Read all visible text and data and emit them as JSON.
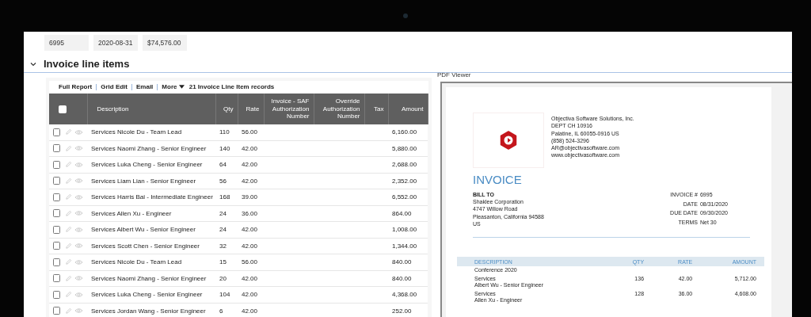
{
  "record_fields": [
    "6995",
    "2020-08-31",
    "$74,576.00"
  ],
  "section": {
    "title": "Invoice line items",
    "expanded": true
  },
  "grid": {
    "toolbar": [
      {
        "label": "Full Report",
        "kind": "link"
      },
      {
        "label": "Grid Edit",
        "kind": "link"
      },
      {
        "label": "Email",
        "kind": "link"
      },
      {
        "label": "More",
        "kind": "menu"
      }
    ],
    "record_count": "21 Invoice Line Item records",
    "select_all_checked": false,
    "columns": [
      {
        "label": "Description",
        "kind": "description"
      },
      {
        "label": "Qty",
        "kind": "qty"
      },
      {
        "label": "Rate",
        "kind": "rate"
      },
      {
        "label": "Invoice - SAF Authorization Number",
        "kind": "saf"
      },
      {
        "label": "Override Authorization Number",
        "kind": "override"
      },
      {
        "label": "Tax",
        "kind": "tax"
      },
      {
        "label": "Amount",
        "kind": "amount"
      }
    ],
    "rows": [
      {
        "checked": false,
        "description": "Services Nicole Du - Team Lead",
        "qty": "110",
        "rate": "56.00",
        "amount": "6,160.00"
      },
      {
        "checked": false,
        "description": "Services Naomi Zhang - Senior Engineer",
        "qty": "140",
        "rate": "42.00",
        "amount": "5,880.00"
      },
      {
        "checked": false,
        "description": "Services Luka Cheng - Senior Engineer",
        "qty": "64",
        "rate": "42.00",
        "amount": "2,688.00"
      },
      {
        "checked": false,
        "description": "Services Liam Lian - Senior Engineer",
        "qty": "56",
        "rate": "42.00",
        "amount": "2,352.00"
      },
      {
        "checked": false,
        "description": "Services Harris Bai - Intermediate Engineer",
        "qty": "168",
        "rate": "39.00",
        "amount": "6,552.00"
      },
      {
        "checked": false,
        "description": "Services Allen Xu - Engineer",
        "qty": "24",
        "rate": "36.00",
        "amount": "864.00"
      },
      {
        "checked": false,
        "description": "Services Albert Wu - Senior Engineer",
        "qty": "24",
        "rate": "42.00",
        "amount": "1,008.00"
      },
      {
        "checked": false,
        "description": "Services Scott Chen - Senior Engineer",
        "qty": "32",
        "rate": "42.00",
        "amount": "1,344.00"
      },
      {
        "checked": false,
        "description": "Services Nicole Du - Team Lead",
        "qty": "15",
        "rate": "56.00",
        "amount": "840.00"
      },
      {
        "checked": false,
        "description": "Services Naomi Zhang - Senior Engineer",
        "qty": "20",
        "rate": "42.00",
        "amount": "840.00"
      },
      {
        "checked": false,
        "description": "Services Luka Cheng - Senior Engineer",
        "qty": "104",
        "rate": "42.00",
        "amount": "4,368.00"
      },
      {
        "checked": false,
        "description": "Services Jordan Wang - Senior Engineer",
        "qty": "6",
        "rate": "42.00",
        "amount": "252.00"
      }
    ]
  },
  "pdf_viewer": {
    "label": "PDF Viewer",
    "company": [
      "Objectiva Software Solutions, Inc.",
      "DEPT CH 10916",
      "Palatine, IL  60055-0916 US",
      "(858) 524-3296",
      "AR@objectivasoftware.com",
      "www.objectivasoftware.com"
    ],
    "title": "INVOICE",
    "bill_to": {
      "heading": "BILL TO",
      "lines": [
        "Shaklee Corporation",
        "4747 Willow Road",
        "Pleasanton, California  94588",
        "US"
      ]
    },
    "meta": [
      {
        "label": "INVOICE #",
        "value": "6995"
      },
      {
        "label": "DATE",
        "value": "08/31/2020"
      },
      {
        "label": "DUE DATE",
        "value": "09/30/2020"
      },
      {
        "label": "TERMS",
        "value": "Net 30"
      }
    ],
    "columns": [
      "DESCRIPTION",
      "QTY",
      "RATE",
      "AMOUNT"
    ],
    "group": "Conference 2020",
    "items": [
      {
        "description": "Services",
        "detail": "Albert Wu - Senior Engineer",
        "qty": "136",
        "rate": "42.00",
        "amount": "5,712.00"
      },
      {
        "description": "Services",
        "detail": "Allen Xu - Engineer",
        "qty": "128",
        "rate": "36.00",
        "amount": "4,608.00"
      }
    ]
  }
}
